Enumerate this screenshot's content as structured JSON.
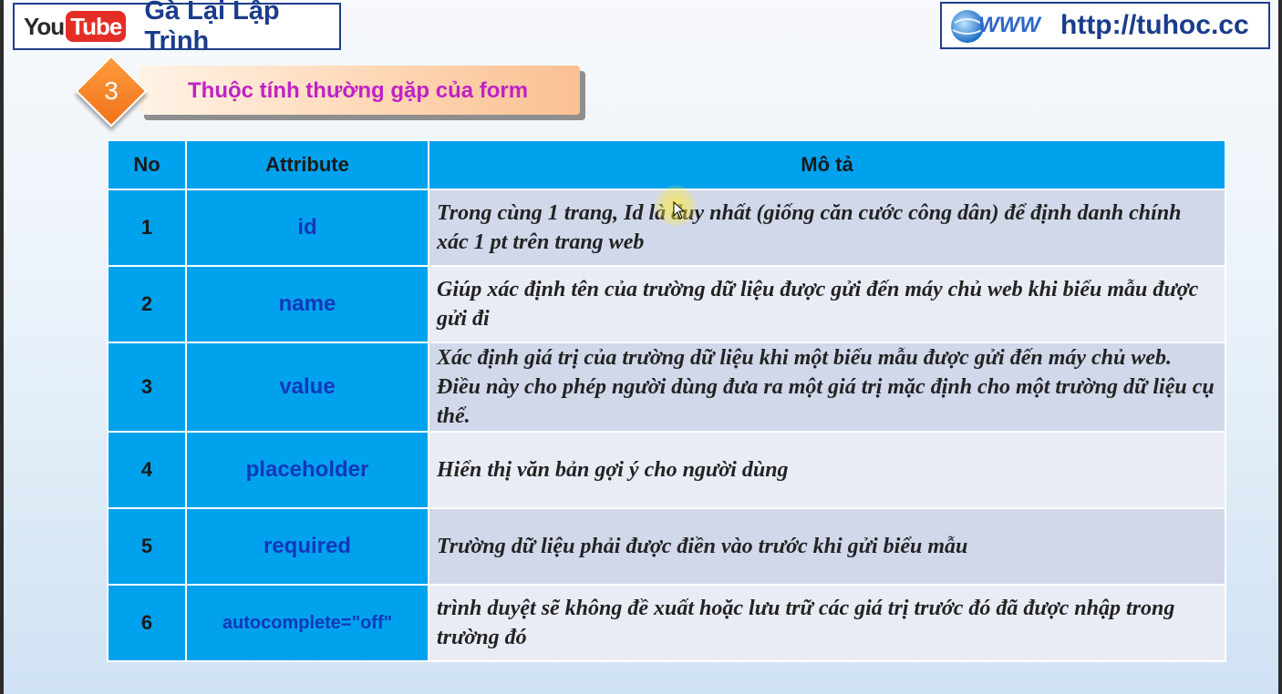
{
  "header": {
    "youtube_you": "You",
    "youtube_tube": "Tube",
    "channel_name": "Gà Lại Lập Trình",
    "site_url": "http://tuhoc.cc",
    "globe_text": "WWW"
  },
  "section": {
    "number": "3",
    "title": "Thuộc tính thường gặp của form"
  },
  "table": {
    "headers": [
      "No",
      "Attribute",
      "Mô tả"
    ],
    "rows": [
      {
        "no": "1",
        "attribute": "id",
        "description": "Trong cùng 1 trang, Id là duy nhất (giống căn cước công dân) để định danh chính xác 1 pt trên trang web"
      },
      {
        "no": "2",
        "attribute": "name",
        "description": "Giúp xác định tên của trường dữ liệu được gửi đến máy chủ web khi biểu mẫu được gửi đi"
      },
      {
        "no": "3",
        "attribute": "value",
        "description": "Xác định giá trị của trường dữ liệu khi một biểu mẫu được gửi đến máy chủ web. Điều này cho phép người dùng đưa ra một giá trị mặc định cho một trường dữ liệu cụ thể."
      },
      {
        "no": "4",
        "attribute": "placeholder",
        "description": "Hiển thị văn bản gợi ý cho người dùng"
      },
      {
        "no": "5",
        "attribute": "required",
        "description": "Trường dữ liệu phải được điền vào trước khi gửi biểu mẫu"
      },
      {
        "no": "6",
        "attribute": "autocomplete=\"off\"",
        "description": "trình duyệt sẽ không đề xuất hoặc lưu trữ các giá trị trước đó đã được nhập trong trường đó"
      }
    ]
  },
  "colors": {
    "header_blue": "#00a2ee",
    "attribute_text": "#1238b8",
    "title_magenta": "#c021c6",
    "badge_orange": "#f0721c"
  }
}
